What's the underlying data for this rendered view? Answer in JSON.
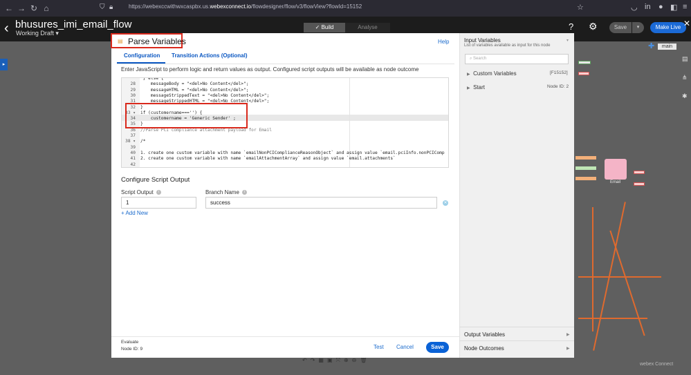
{
  "browser": {
    "url_prefix": "https://webexccwithwxcaspbx.us.",
    "url_domain": "webexconnect.io",
    "url_suffix": "/flowdesigner/flow/v3/flowView?flowId=15152"
  },
  "app": {
    "flow_name": "bhusures_imi_email_flow",
    "status": "Working Draft",
    "tabs": {
      "build": "Build",
      "analyse": "Analyse"
    },
    "save": "Save",
    "make_live": "Make Live",
    "help": "?"
  },
  "canvas": {
    "main_label": "main",
    "email_label": "Email",
    "brand": "webex Connect"
  },
  "modal": {
    "title": "Parse Variables",
    "help": "Help",
    "tabs": [
      "Configuration",
      "Transition Actions (Optional)"
    ],
    "description": "Enter JavaScript to perform logic and return values as output. Configured script outputs will be available as node outcome",
    "code_lines": [
      {
        "n": "",
        "t": " } else {"
      },
      {
        "n": "28",
        "t": "    messageBody = \"<del>No Content</del>\";"
      },
      {
        "n": "29",
        "t": "    messageHTML = \"<del>No Content</del>\";"
      },
      {
        "n": "30",
        "t": "    messageStrippedText = \"<del>No Content</del>\";"
      },
      {
        "n": "31",
        "t": "    messageStrippedHTML = \"<del>No Content</del>\";"
      },
      {
        "n": "32",
        "t": "}"
      },
      {
        "n": "33 ▾",
        "t": "if (customername==='') {"
      },
      {
        "n": "34",
        "t": "    customername = 'Generic Sender' ;"
      },
      {
        "n": "35",
        "t": "}"
      },
      {
        "n": "36",
        "t": "//Parse PCI compliance attachment payload for Email"
      },
      {
        "n": "37",
        "t": ""
      },
      {
        "n": "38 ▾",
        "t": "/*"
      },
      {
        "n": "39",
        "t": ""
      },
      {
        "n": "40",
        "t": "1. create one custom variable with name `emailNonPCIComplianceReasonObject` and assign value `email.pciInfo.nonPCIComp"
      },
      {
        "n": "41",
        "t": "2. create one custom variable with name `emailAttachmentArray` and assign value `email.attachments`"
      },
      {
        "n": "42",
        "t": ""
      }
    ],
    "script_output_section": "Configure Script Output",
    "script_output_label": "Script Output",
    "script_output_value": "1",
    "branch_name_label": "Branch Name",
    "branch_name_value": "success",
    "add_new": "+ Add New",
    "footer": {
      "evaluate": "Evaluate",
      "node_id": "Node ID: 9",
      "test": "Test",
      "cancel": "Cancel",
      "save": "Save"
    }
  },
  "input_panel": {
    "title": "Input Variables",
    "subtitle": "List of variables available as input for this node",
    "search_placeholder": "Search",
    "custom_variables": "Custom Variables",
    "custom_variables_id": "[F15152]",
    "start": "Start",
    "start_node_id": "Node ID: 2",
    "output_variables": "Output Variables",
    "node_outcomes": "Node Outcomes"
  }
}
